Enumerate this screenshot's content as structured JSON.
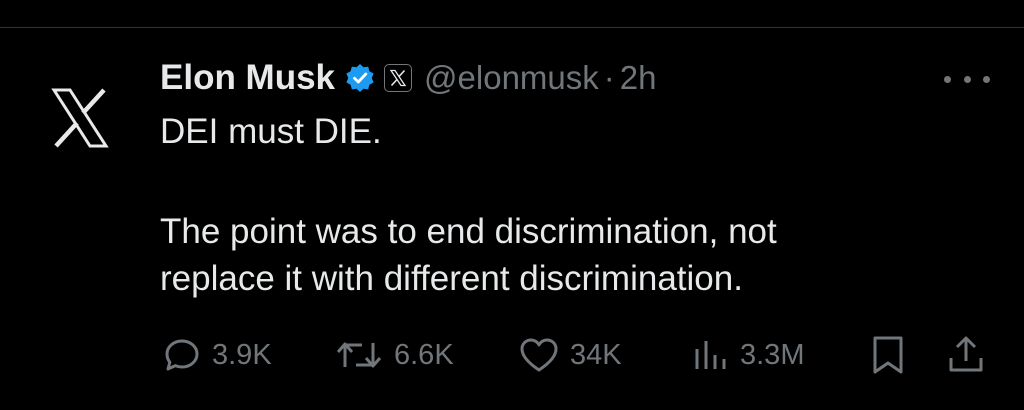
{
  "author": {
    "name": "Elon Musk",
    "handle": "@elonmusk",
    "separator": "·",
    "time": "2h",
    "avatar_icon": "x-logo-icon",
    "verified_icon": "verified-badge-icon",
    "affiliation_icon": "x-affiliation-badge-icon"
  },
  "tweet": {
    "line1": "DEI must DIE.",
    "line2": "The point was to end discrimination, not",
    "line3": "replace it with different discrimination."
  },
  "actions": {
    "replies": {
      "icon": "reply-icon",
      "count": "3.9K"
    },
    "reposts": {
      "icon": "repost-icon",
      "count": "6.6K"
    },
    "likes": {
      "icon": "heart-icon",
      "count": "34K"
    },
    "views": {
      "icon": "views-icon",
      "count": "3.3M"
    },
    "bookmark": {
      "icon": "bookmark-icon"
    },
    "share": {
      "icon": "share-icon"
    }
  },
  "more_icon": "more-icon",
  "colors": {
    "background": "#000000",
    "text": "#e7e9ea",
    "muted": "#71767b",
    "verified": "#1d9bf0",
    "divider": "#2f3336"
  }
}
